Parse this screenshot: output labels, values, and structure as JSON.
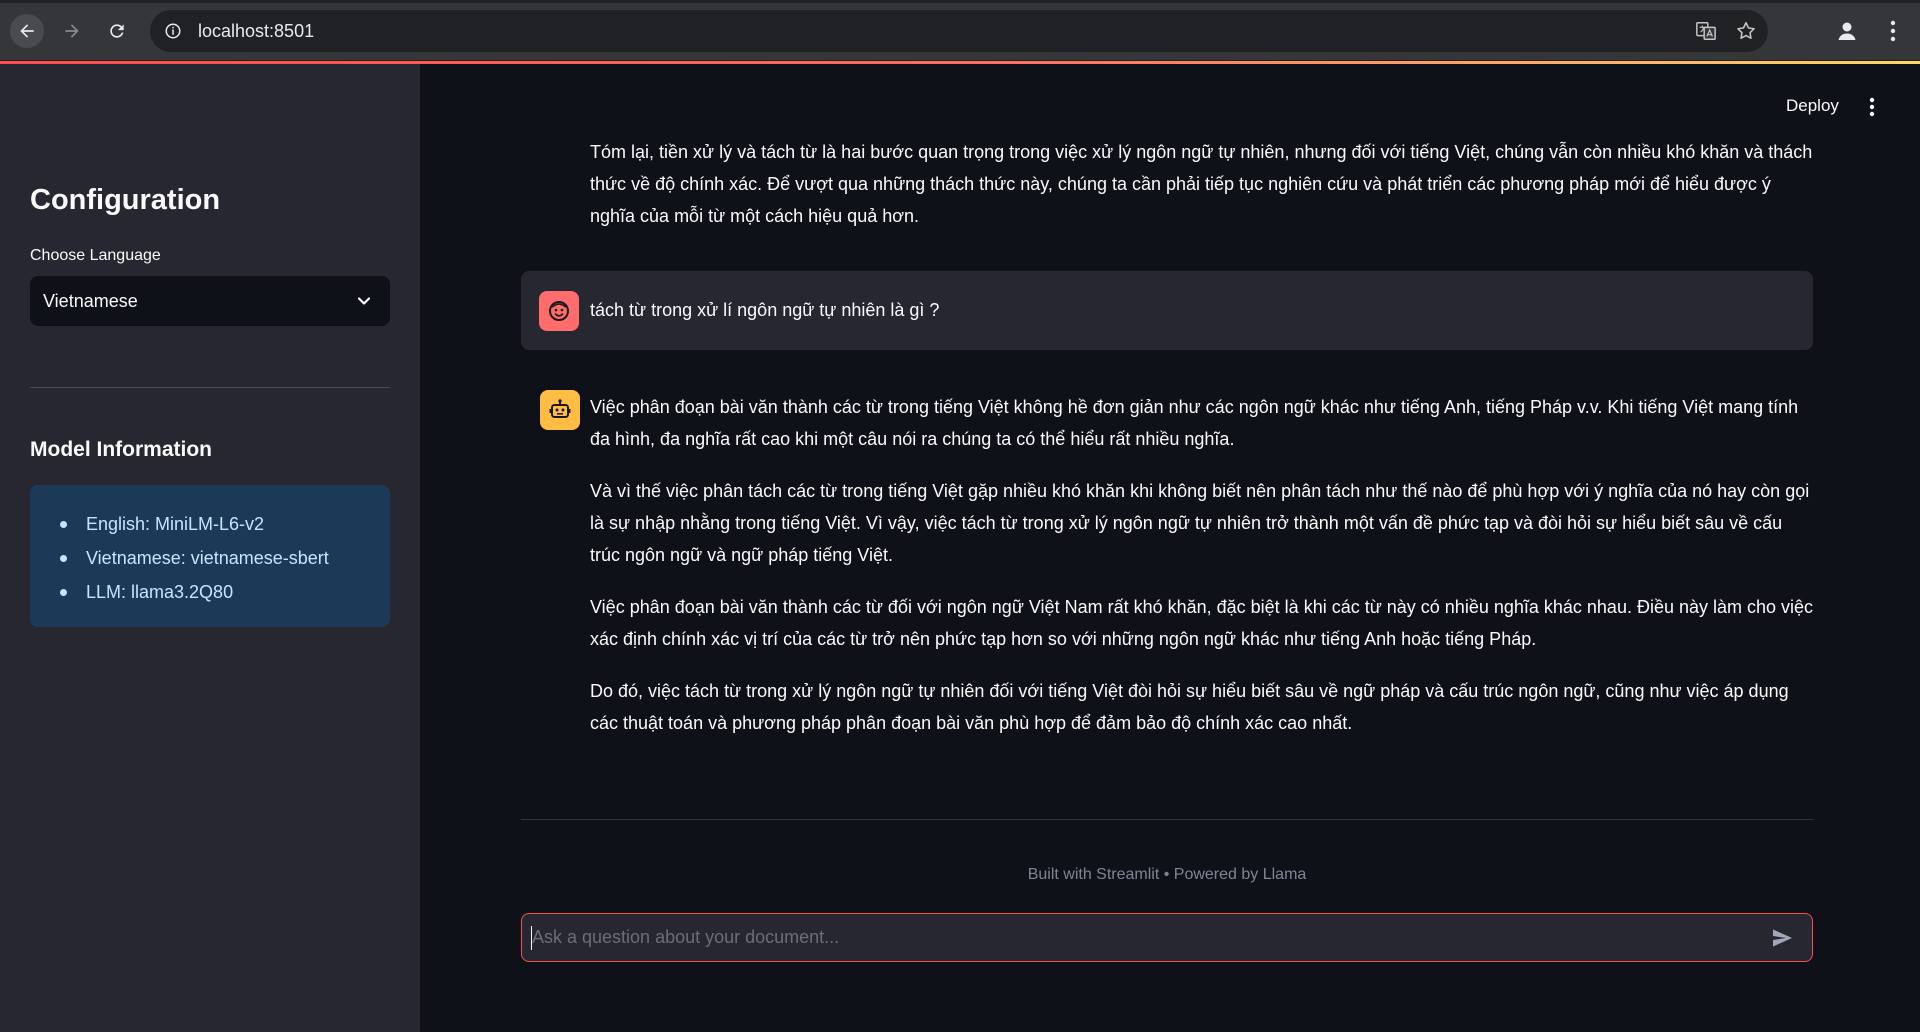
{
  "browser": {
    "url": "localhost:8501",
    "icons": [
      "back-arrow-icon",
      "forward-arrow-icon",
      "reload-icon",
      "site-info-icon",
      "translate-icon",
      "bookmark-star-icon",
      "profile-icon",
      "browser-menu-icon"
    ]
  },
  "sidebar": {
    "title": "Configuration",
    "language_label": "Choose Language",
    "language_value": "Vietnamese",
    "model_info_title": "Model Information",
    "model_info_items": [
      "English: MiniLM-L6-v2",
      "Vietnamese: vietnamese-sbert",
      "LLM: llama3.2Q80"
    ]
  },
  "header": {
    "deploy_label": "Deploy"
  },
  "chat": {
    "previous_answer_tail": "Tóm lại, tiền xử lý và tách từ là hai bước quan trọng trong việc xử lý ngôn ngữ tự nhiên, nhưng đối với tiếng Việt, chúng vẫn còn nhiều khó khăn và thách thức về độ chính xác. Để vượt qua những thách thức này, chúng ta cần phải tiếp tục nghiên cứu và phát triển các phương pháp mới để hiểu được ý nghĩa của mỗi từ một cách hiệu quả hơn.",
    "user_question": "tách từ trong xử lí ngôn ngữ tự nhiên là gì ?",
    "assistant_paragraphs": [
      "Việc phân đoạn bài văn thành các từ trong tiếng Việt không hề đơn giản như các ngôn ngữ khác như tiếng Anh, tiếng Pháp v.v. Khi tiếng Việt mang tính đa hình, đa nghĩa rất cao khi một câu nói ra chúng ta có thể hiểu rất nhiều nghĩa.",
      "Và vì thế việc phân tách các từ trong tiếng Việt gặp nhiều khó khăn khi không biết nên phân tách như thế nào để phù hợp với ý nghĩa của nó hay còn gọi là sự nhập nhằng trong tiếng Việt. Vì vậy, việc tách từ trong xử lý ngôn ngữ tự nhiên trở thành một vấn đề phức tạp và đòi hỏi sự hiểu biết sâu về cấu trúc ngôn ngữ và ngữ pháp tiếng Việt.",
      "Việc phân đoạn bài văn thành các từ đối với ngôn ngữ Việt Nam rất khó khăn, đặc biệt là khi các từ này có nhiều nghĩa khác nhau. Điều này làm cho việc xác định chính xác vị trí của các từ trở nên phức tạp hơn so với những ngôn ngữ khác như tiếng Anh hoặc tiếng Pháp.",
      "Do đó, việc tách từ trong xử lý ngôn ngữ tự nhiên đối với tiếng Việt đòi hỏi sự hiểu biết sâu về ngữ pháp và cấu trúc ngôn ngữ, cũng như việc áp dụng các thuật toán và phương pháp phân đoạn bài văn phù hợp để đảm bảo độ chính xác cao nhất."
    ]
  },
  "footer": {
    "text": "Built with Streamlit • Powered by Llama"
  },
  "input": {
    "placeholder": "Ask a question about your document...",
    "value": ""
  },
  "colors": {
    "accent": "#ff4b4b",
    "sidebar_bg": "#262730",
    "main_bg": "#0e1117",
    "info_box_bg": "#1c3a57",
    "user_avatar": "#ff6c6c",
    "bot_avatar": "#ffbd45"
  }
}
